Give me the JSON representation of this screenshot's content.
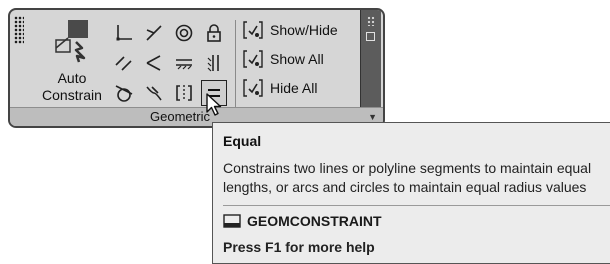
{
  "panel": {
    "auto_constrain_label": "Auto Constrain",
    "title": "Geometric",
    "tools": [
      {
        "name": "coincident"
      },
      {
        "name": "collinear"
      },
      {
        "name": "concentric"
      },
      {
        "name": "fix"
      },
      {
        "name": "parallel"
      },
      {
        "name": "perpendicular"
      },
      {
        "name": "horizontal"
      },
      {
        "name": "vertical"
      },
      {
        "name": "tangent"
      },
      {
        "name": "smooth"
      },
      {
        "name": "symmetric"
      },
      {
        "name": "equal"
      }
    ],
    "visibility": {
      "show_hide": "Show/Hide",
      "show_all": "Show All",
      "hide_all": "Hide All"
    }
  },
  "tooltip": {
    "title": "Equal",
    "description_line1": "Constrains two lines or polyline segments to maintain equal",
    "description_line2": "lengths, or arcs and circles to maintain equal radius values",
    "command": "GEOMCONSTRAINT",
    "help": "Press F1 for more help"
  }
}
